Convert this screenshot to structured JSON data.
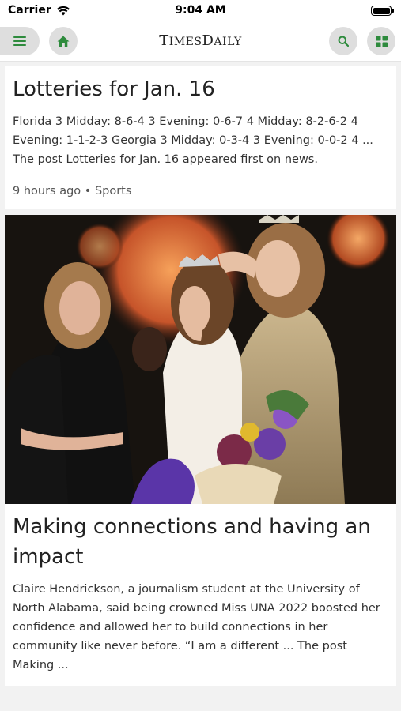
{
  "status_bar": {
    "carrier": "Carrier",
    "time": "9:04 AM"
  },
  "app_bar": {
    "logo_big_1": "T",
    "logo_small_1": "IMES",
    "logo_big_2": "D",
    "logo_small_2": "AILY",
    "menu_icon": "hamburger-icon",
    "home_icon": "home-icon",
    "search_icon": "search-icon",
    "grid_icon": "grid-icon",
    "accent_color": "#2e8b3d"
  },
  "articles": [
    {
      "headline": "Lotteries for Jan. 16",
      "excerpt": "Florida 3 Midday: 8-6-4 3 Evening: 0-6-7 4 Midday: 8-2-6-2 4 Evening: 1-1-2-3 Georgia 3 Midday: 0-3-4 3 Evening: 0-0-2 4 ... The post Lotteries for Jan. 16 appeared first on news.",
      "meta": "9 hours ago • Sports"
    },
    {
      "headline": "Making connections and having an impact",
      "excerpt": "Claire Hendrickson, a journalism student at the University of North Alabama, said being crowned Miss UNA 2022 boosted her confidence and allowed her to build connections in her community like never before. “I am a different ... The post Making ..."
    }
  ]
}
